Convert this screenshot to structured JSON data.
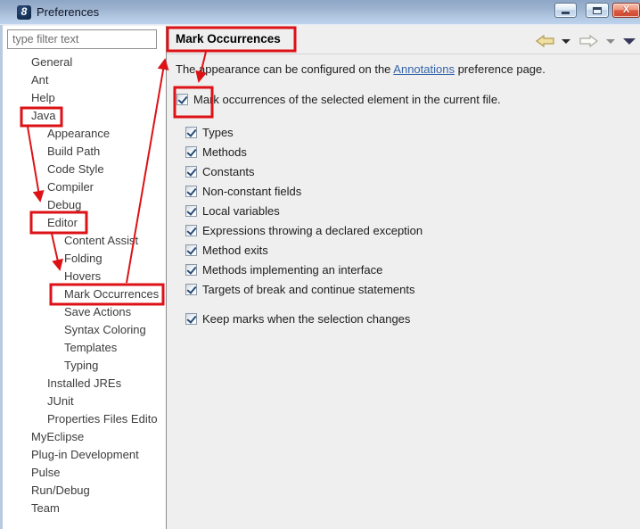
{
  "window": {
    "title": "Preferences"
  },
  "sidebar": {
    "filter_text": "type filter text",
    "tree": [
      {
        "label": "General",
        "level": 1
      },
      {
        "label": "Ant",
        "level": 1
      },
      {
        "label": "Help",
        "level": 1
      },
      {
        "label": "Java",
        "level": 1,
        "annotated": true
      },
      {
        "label": "Appearance",
        "level": 2
      },
      {
        "label": "Build Path",
        "level": 2
      },
      {
        "label": "Code Style",
        "level": 2
      },
      {
        "label": "Compiler",
        "level": 2
      },
      {
        "label": "Debug",
        "level": 2
      },
      {
        "label": "Editor",
        "level": 2,
        "annotated": true
      },
      {
        "label": "Content Assist",
        "level": 3
      },
      {
        "label": "Folding",
        "level": 3
      },
      {
        "label": "Hovers",
        "level": 3
      },
      {
        "label": "Mark Occurrences",
        "level": 3,
        "annotated": true
      },
      {
        "label": "Save Actions",
        "level": 3
      },
      {
        "label": "Syntax Coloring",
        "level": 3
      },
      {
        "label": "Templates",
        "level": 3
      },
      {
        "label": "Typing",
        "level": 3
      },
      {
        "label": "Installed JREs",
        "level": 2
      },
      {
        "label": "JUnit",
        "level": 2
      },
      {
        "label": "Properties Files Edito",
        "level": 2
      },
      {
        "label": "MyEclipse",
        "level": 1
      },
      {
        "label": "Plug-in Development",
        "level": 1
      },
      {
        "label": "Pulse",
        "level": 1
      },
      {
        "label": "Run/Debug",
        "level": 1
      },
      {
        "label": "Team",
        "level": 1
      }
    ]
  },
  "content": {
    "page_title": "Mark Occurrences",
    "intro": {
      "prefix": "The appearance can be configured on the ",
      "link": "Annotations",
      "suffix": " preference page."
    },
    "master_checkbox": {
      "label": "Mark occurrences of the selected element in the current file.",
      "checked": true
    },
    "options": [
      {
        "label": "Types",
        "checked": true
      },
      {
        "label": "Methods",
        "checked": true
      },
      {
        "label": "Constants",
        "checked": true
      },
      {
        "label": "Non-constant fields",
        "checked": true
      },
      {
        "label": "Local variables",
        "checked": true
      },
      {
        "label": "Expressions throwing a declared exception",
        "checked": true
      },
      {
        "label": "Method exits",
        "checked": true
      },
      {
        "label": "Methods implementing an interface",
        "checked": true
      },
      {
        "label": "Targets of break and continue statements",
        "checked": true
      }
    ],
    "footer_checkbox": {
      "label": "Keep marks when the selection changes",
      "checked": true
    }
  },
  "annotations": {
    "red_boxes": [
      "tree-item-java",
      "tree-item-editor",
      "tree-item-mark-occurrences",
      "page-title",
      "master-checkbox"
    ],
    "red_arrows": [
      "java-to-editor",
      "editor-to-mark-occurrences",
      "tree-mark-occurrences-to-page-title",
      "page-title-to-master-checkbox"
    ]
  },
  "colors": {
    "annotation_red": "#dc1216",
    "link_blue": "#3465a8"
  }
}
